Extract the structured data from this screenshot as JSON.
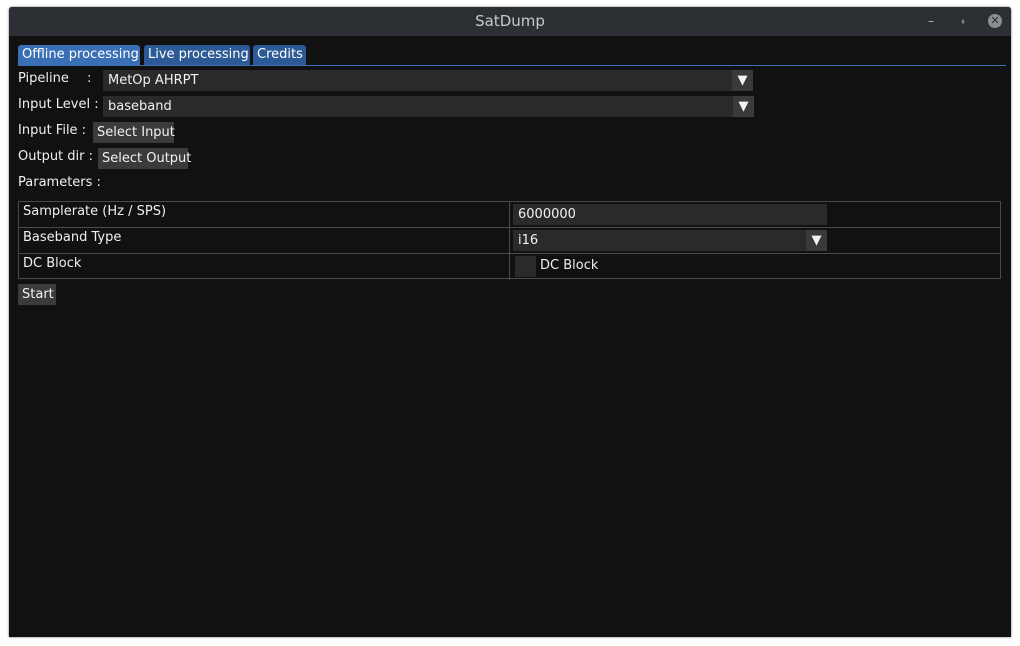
{
  "window": {
    "title": "SatDump",
    "controls": {
      "minimize_glyph": "–",
      "maximize_glyph": "⬫",
      "close_glyph": "✕"
    }
  },
  "tabs": [
    {
      "label": "Offline processing",
      "active": true
    },
    {
      "label": "Live processing",
      "active": false
    },
    {
      "label": "Credits",
      "active": false
    }
  ],
  "form": {
    "pipeline_label": "Pipeline",
    "pipeline_colon": ":",
    "pipeline_value": "MetOp AHRPT",
    "input_level_label": "Input Level :",
    "input_level_value": "baseband",
    "input_file_label": "Input File :",
    "select_input_label": "Select Input",
    "output_dir_label": "Output dir :",
    "select_output_label": "Select Output",
    "parameters_label": "Parameters :"
  },
  "parameters": {
    "samplerate": {
      "name": "Samplerate (Hz / SPS)",
      "value": "6000000"
    },
    "baseband_type": {
      "name": "Baseband Type",
      "value": "i16"
    },
    "dc_block": {
      "name": "DC Block",
      "checkbox_label": "DC Block",
      "checked": false
    }
  },
  "actions": {
    "start_label": "Start"
  },
  "colors": {
    "accent": "#3a6fb5",
    "background": "#111112",
    "titlebar": "#2c2f33",
    "widget": "#2a2a2c"
  }
}
